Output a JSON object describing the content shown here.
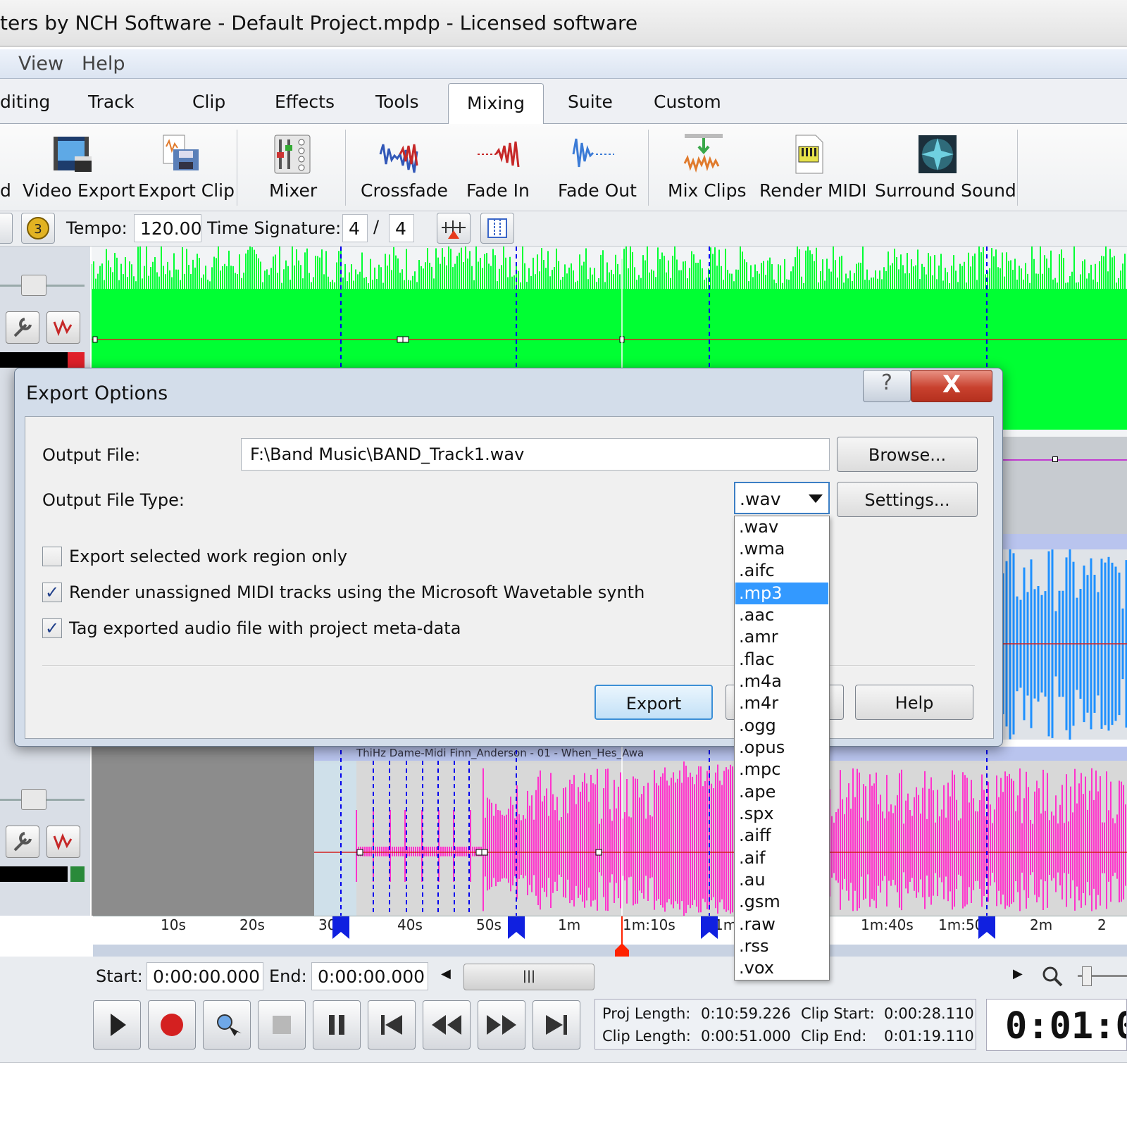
{
  "window": {
    "title": "ters by NCH Software - Default Project.mpdp - Licensed software"
  },
  "menu": {
    "items": [
      "View",
      "Help"
    ]
  },
  "tabs": [
    "diting",
    "Track",
    "Clip",
    "Effects",
    "Tools",
    "Mixing",
    "Suite",
    "Custom"
  ],
  "active_tab": "Mixing",
  "ribbon": {
    "buttons": [
      "d",
      "Video Export",
      "Export Clip",
      "Mixer",
      "Crossfade",
      "Fade In",
      "Fade Out",
      "Mix Clips",
      "Render MIDI",
      "Surround Sound"
    ]
  },
  "tempo": {
    "label": "Tempo:",
    "value": "120.00",
    "sig_label": "Time Signature:",
    "sig_num": "4",
    "sig_sep": "/",
    "sig_den": "4"
  },
  "clips": {
    "label_strip": "ThiHz  Dame-Midi   Finn_Anderson - 01 - When_Hes_Awa"
  },
  "ruler": {
    "ticks": [
      "10s",
      "20s",
      "30",
      "40s",
      "50s",
      "1m",
      "1m:10s",
      "1m:2",
      "1m:40s",
      "1m:50",
      "2m",
      "2"
    ]
  },
  "range": {
    "start_label": "Start:",
    "start_value": "0:00:00.000",
    "end_label": "End:",
    "end_value": "0:00:00.000"
  },
  "status": {
    "proj_length_label": "Proj Length:",
    "proj_length": "0:10:59.226",
    "clip_start_label": "Clip Start:",
    "clip_start": "0:00:28.110",
    "clip_length_label": "Clip Length:",
    "clip_length": "0:00:51.000",
    "clip_end_label": "Clip End:",
    "clip_end": "0:01:19.110"
  },
  "clock": "0:01:0",
  "dialog": {
    "title": "Export Options",
    "help_glyph": "?",
    "close_glyph": "X",
    "output_file_label": "Output File:",
    "output_file_value": "F:\\Band Music\\BAND_Track1.wav",
    "browse_label": "Browse...",
    "output_type_label": "Output File Type:",
    "output_type_value": ".wav",
    "settings_label": "Settings...",
    "checks": [
      {
        "label": "Export selected work region only",
        "checked": false
      },
      {
        "label": "Render unassigned MIDI tracks using the Microsoft Wavetable synth",
        "checked": true
      },
      {
        "label": "Tag exported audio file with project meta-data",
        "checked": true
      }
    ],
    "export_label": "Export",
    "help_label": "Help"
  },
  "dropdown": {
    "options": [
      ".wav",
      ".wma",
      ".aifc",
      ".mp3",
      ".aac",
      ".amr",
      ".flac",
      ".m4a",
      ".m4r",
      ".ogg",
      ".opus",
      ".mpc",
      ".ape",
      ".spx",
      ".aiff",
      ".aif",
      ".au",
      ".gsm",
      ".raw",
      ".rss",
      ".vox"
    ],
    "highlighted": ".mp3"
  },
  "colors": {
    "track1_wave": "#00ff33",
    "track2_wave": "#1e90ff",
    "track3_wave": "#ff33cc",
    "accent": "#3399ff",
    "marker": "#0000ee",
    "playhead": "#ff2200"
  }
}
